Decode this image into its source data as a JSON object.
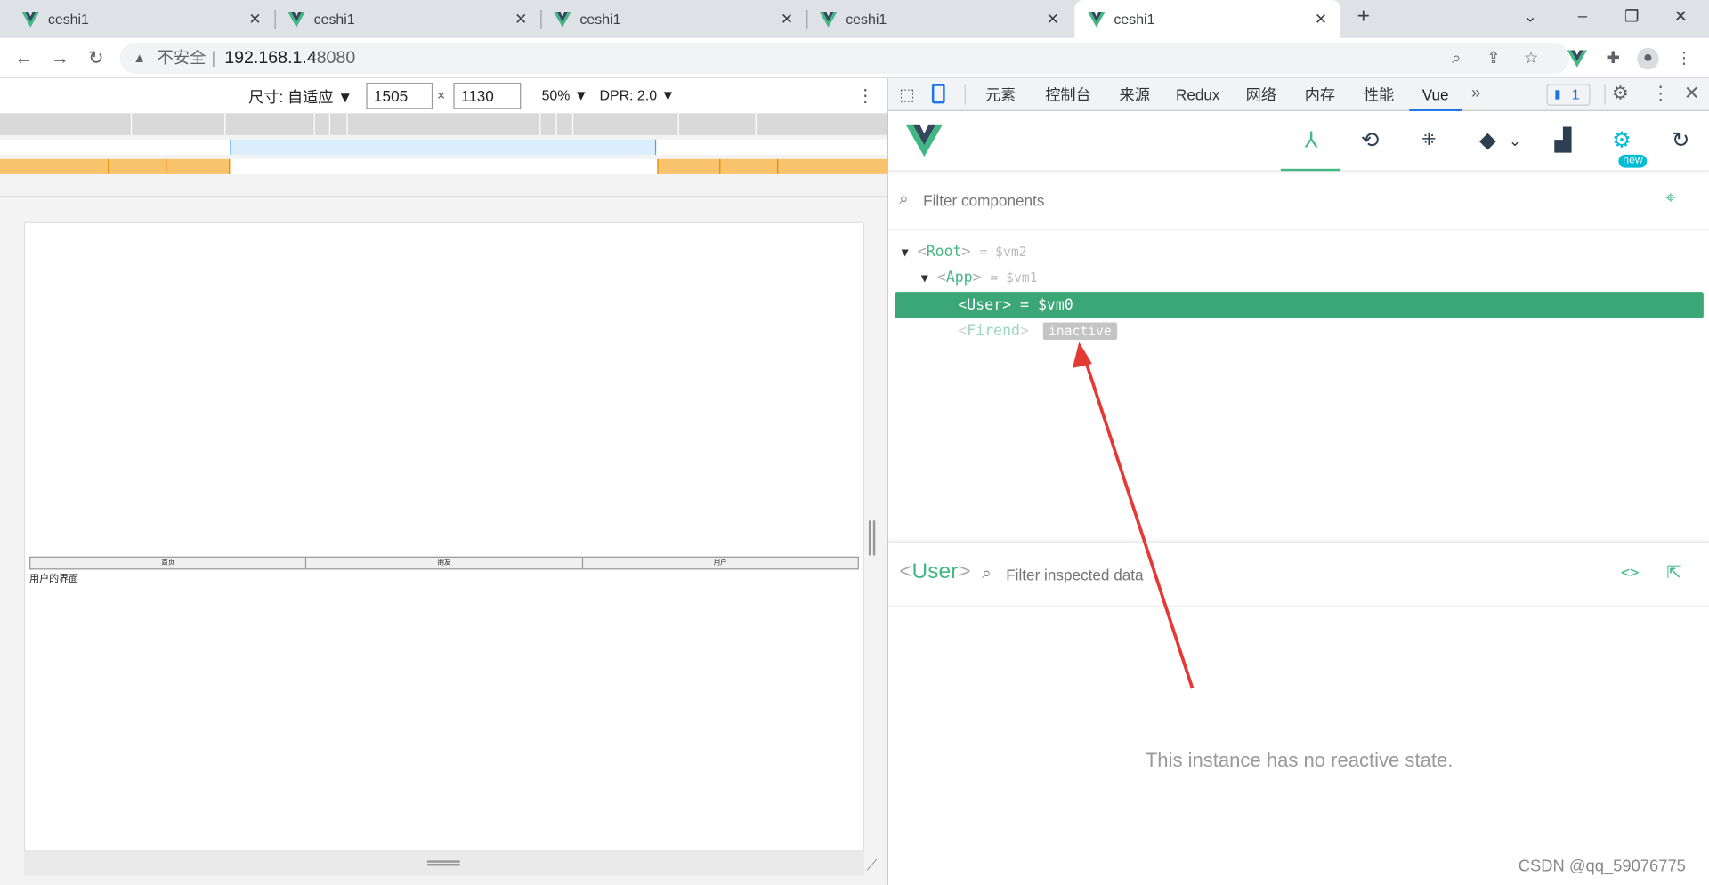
{
  "browser": {
    "tabs": [
      {
        "title": "ceshi1"
      },
      {
        "title": "ceshi1"
      },
      {
        "title": "ceshi1"
      },
      {
        "title": "ceshi1"
      },
      {
        "title": "ceshi1"
      }
    ],
    "new_tab": "+",
    "security_label": "不安全",
    "url_host": "192.168.1.4",
    "url_port": ":8080"
  },
  "device_toolbar": {
    "size_label": "尺寸: 自适应",
    "width": "1505",
    "times": "×",
    "height": "1130",
    "zoom": "50%",
    "dpr": "DPR: 2.0"
  },
  "page": {
    "nav": [
      "首页",
      "朋友",
      "用户"
    ],
    "content_text": "用户的界面"
  },
  "devtools": {
    "tabs": [
      "元素",
      "控制台",
      "来源",
      "Redux",
      "网络",
      "内存",
      "性能",
      "Vue"
    ],
    "issues_count": "1",
    "vue": {
      "new_badge": "new",
      "filter_placeholder": "Filter components",
      "tree": [
        {
          "name": "Root",
          "ref": "= $vm2"
        },
        {
          "name": "App",
          "ref": "= $vm1"
        },
        {
          "name": "User",
          "ref": "= $vm0"
        },
        {
          "name": "Firend",
          "badge": "inactive"
        }
      ],
      "inspected_name": "User",
      "inspect_filter_placeholder": "Filter inspected data",
      "empty_state": "This instance has no reactive state."
    }
  },
  "watermark": "CSDN @qq_59076775",
  "colors": {
    "vue_green": "#42b983",
    "selected_row": "#3ba776",
    "arrow": "#e53935"
  }
}
